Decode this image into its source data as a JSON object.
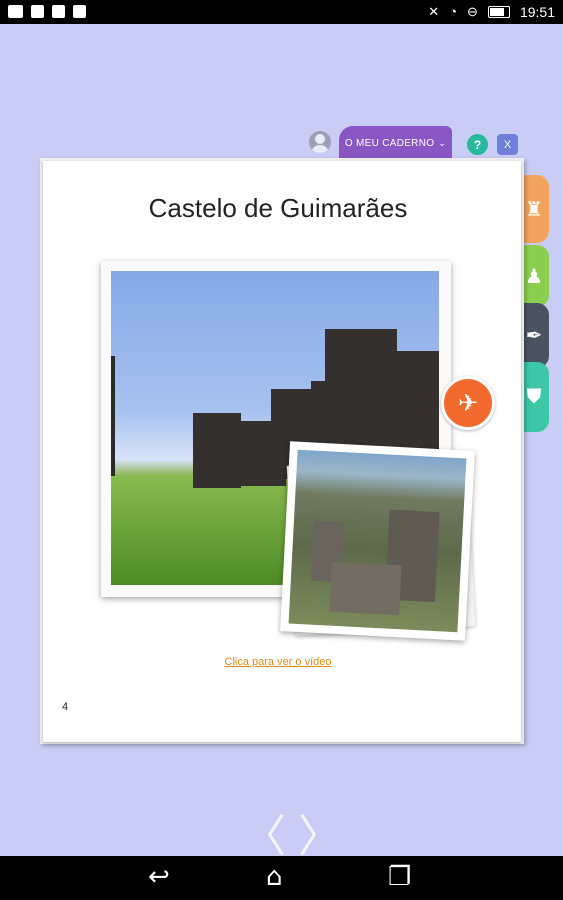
{
  "status_bar": {
    "time": "19:51",
    "icons": [
      "notification-icon",
      "flipboard-icon",
      "sd-card-icon",
      "download-icon",
      "mute-icon",
      "wifi-icon",
      "battery-icon"
    ]
  },
  "header": {
    "notebook_label": "O MEU CADERNO",
    "help_label": "?",
    "close_label": "X"
  },
  "side_tabs": [
    {
      "name": "castle-tab",
      "icon": "castle-icon",
      "color": "#f2a45e"
    },
    {
      "name": "pawn-tab",
      "icon": "pawn-icon",
      "color": "#8ccf50"
    },
    {
      "name": "feather-tab",
      "icon": "feather-icon",
      "color": "#4a5460"
    },
    {
      "name": "shield-tab",
      "icon": "shield-icon",
      "color": "#3cc7a6"
    }
  ],
  "page": {
    "title": "Castelo de Guimarães",
    "video_link": "Clica para ver o vídeo",
    "number": "4"
  },
  "nav": {
    "prev": "〈",
    "next": "〉"
  },
  "colors": {
    "background": "#c9cdf5",
    "notebook_tab": "#8a56c4",
    "help_button": "#26b99a",
    "close_button": "#6f7fdb",
    "drone_badge": "#f26a2e",
    "link": "#d88a18"
  }
}
